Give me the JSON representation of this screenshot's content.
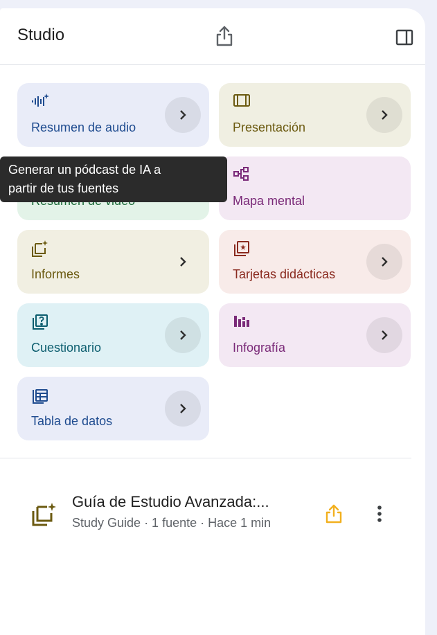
{
  "header": {
    "title": "Studio",
    "share_icon": "share-icon",
    "panel_icon": "panel-toggle-icon"
  },
  "cards": [
    {
      "label": "Resumen de audio",
      "icon": "audio-waveform-icon",
      "bg": "#e9ecf8",
      "fg": "#1e4b8f"
    },
    {
      "label": "Presentación",
      "icon": "slides-icon",
      "bg": "#f0efe2",
      "fg": "#6b5a10"
    },
    {
      "label": "Resumen de video",
      "icon": "video-icon",
      "bg": "#e3f3e8",
      "fg": "#1d6b3a"
    },
    {
      "label": "Mapa mental",
      "icon": "mind-map-icon",
      "bg": "#f3e8f3",
      "fg": "#7a2a78"
    },
    {
      "label": "Informes",
      "icon": "reports-icon",
      "bg": "#f1efe2",
      "fg": "#6b5a10"
    },
    {
      "label": "Tarjetas didácticas",
      "icon": "flashcards-icon",
      "bg": "#f8ebe9",
      "fg": "#8a2a1f"
    },
    {
      "label": "Cuestionario",
      "icon": "quiz-icon",
      "bg": "#dff1f5",
      "fg": "#0b5d6e"
    },
    {
      "label": "Infografía",
      "icon": "infographic-icon",
      "bg": "#f3e8f3",
      "fg": "#7a2a78"
    },
    {
      "label": "Tabla de datos",
      "icon": "data-table-icon",
      "bg": "#e9ecf8",
      "fg": "#1e4b8f"
    }
  ],
  "tooltip": {
    "text_line1": "Generar un pódcast de IA a",
    "text_line2": "partir de tus fuentes"
  },
  "note": {
    "title": "Guía de Estudio Avanzada:...",
    "meta": "Study Guide · 1 fuente · Hace 1 min",
    "icon": "study-guide-icon",
    "share_color": "#f2b01e"
  }
}
